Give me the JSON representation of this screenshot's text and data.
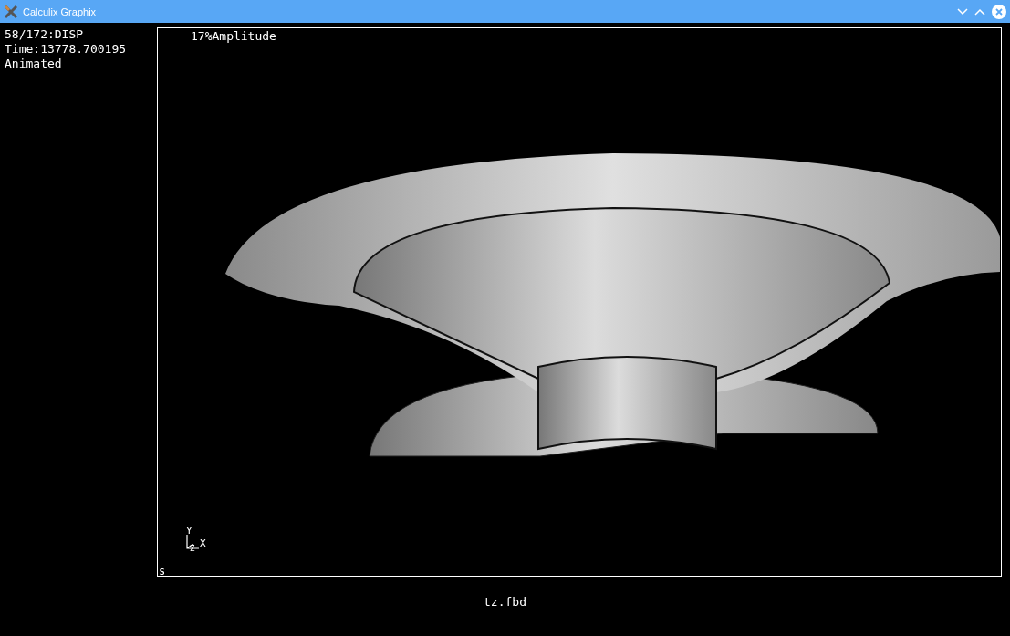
{
  "window": {
    "title": "Calculix Graphix"
  },
  "info_lines": [
    "58/172:DISP",
    "Time:13778.700195",
    "Animated"
  ],
  "viewport": {
    "amplitude": "17%Amplitude",
    "axes": {
      "y": "Y",
      "x": "X",
      "z": "Z"
    },
    "corner_mark": "s"
  },
  "filename": "tz.fbd"
}
